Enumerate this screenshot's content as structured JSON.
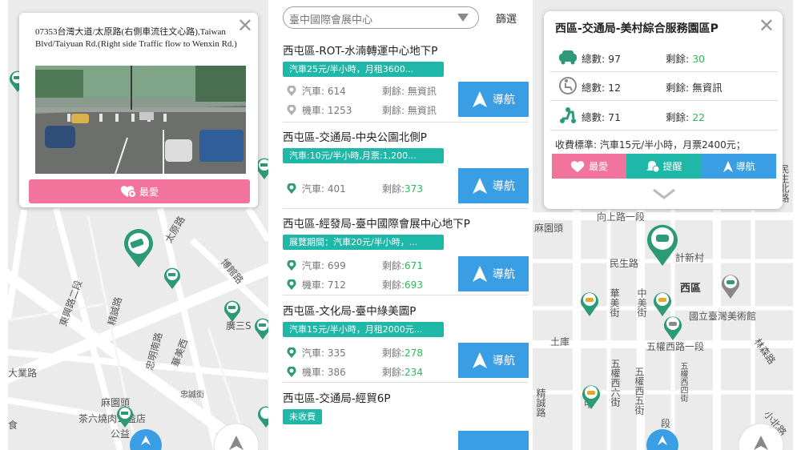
{
  "panel1": {
    "address": "07353台灣大道/太原路(右側車流往文心路),Taiwan Blvd/Taiyuan Rd.(Right side Traffic flow to Wenxin Rd.)",
    "favorite_label": "最愛",
    "map_labels": [
      "太原路",
      "博館路",
      "東興路二段",
      "精誠路",
      "忠明南路",
      "華美西",
      "廣三S",
      "大業路",
      "忠誠街",
      "麻園頭",
      "茶六燒肉公益店",
      "公益",
      "食"
    ]
  },
  "panel2": {
    "search_text": "臺中國際會展中心",
    "filter_label": "篩選",
    "nav_label": "導航",
    "items": [
      {
        "name": "西屯區-ROT-水湳轉運中心地下P",
        "tag": "汽車25元/半小時，月租3600...",
        "rows": [
          {
            "type": "car",
            "total": "汽車: 614",
            "remain": "剩餘: 無資訊",
            "remain_color": "gray"
          },
          {
            "type": "moto",
            "total": "機車: 1253",
            "remain": "剩餘: 無資訊",
            "remain_color": "gray"
          }
        ]
      },
      {
        "name": "西屯區-交通局-中央公園北側P",
        "tag": "汽車:10元/半小時,月票:1,200...",
        "rows": [
          {
            "type": "car",
            "total": "汽車: 401",
            "remain": "剩餘: ",
            "remain_value": "373"
          }
        ]
      },
      {
        "name": "西屯區-經發局-臺中國際會展中心地下P",
        "tag": "展覽期間：汽車20元/半小時，...",
        "rows": [
          {
            "type": "car",
            "total": "汽車: 699",
            "remain": "剩餘: ",
            "remain_value": "671"
          },
          {
            "type": "moto",
            "total": "機車: 712",
            "remain": "剩餘: ",
            "remain_value": "693"
          }
        ]
      },
      {
        "name": "西屯區-文化局-臺中綠美圖P",
        "tag": "汽車15元/半小時，月租2000元...",
        "rows": [
          {
            "type": "car",
            "total": "汽車: 335",
            "remain": "剩餘: ",
            "remain_value": "278"
          },
          {
            "type": "moto",
            "total": "機車: 386",
            "remain": "剩餘: ",
            "remain_value": "234"
          }
        ]
      },
      {
        "name": "西屯區-交通局-經貿6P",
        "tag": "未收費",
        "rows": []
      }
    ]
  },
  "panel3": {
    "title": "西區-交通局-美村綜合服務園區P",
    "rows": [
      {
        "type": "car",
        "total": "總數: 97",
        "remain_label": "剩餘: ",
        "remain_value": "30",
        "green": true
      },
      {
        "type": "truck",
        "total": "總數: 12",
        "remain_label": "剩餘: ",
        "remain_value": "無資訊",
        "green": false
      },
      {
        "type": "moto",
        "total": "總數: 71",
        "remain_label": "剩餘: ",
        "remain_value": "22",
        "green": true
      }
    ],
    "fee": "收費標準: 汽車15元/半小時，月票2400元；",
    "buttons": {
      "favorite": "最愛",
      "remind": "提醒",
      "navigate": "導航"
    },
    "map_labels": [
      "麻園頭",
      "向上路一段",
      "計新村",
      "民生路",
      "西區",
      "華美街",
      "中美街",
      "國立臺灣美術館",
      "土庫",
      "五權西路一段",
      "林森路",
      "民生北路",
      "五權西六街",
      "五權西五街",
      "五權西四街",
      "精誠路",
      "中",
      "段",
      "小北路"
    ]
  },
  "colors": {
    "teal": "#1fb7a8",
    "blue": "#3a9ee5",
    "pink": "#f2739b",
    "green": "#2eb85c",
    "pin_green": "#2c9a77"
  }
}
